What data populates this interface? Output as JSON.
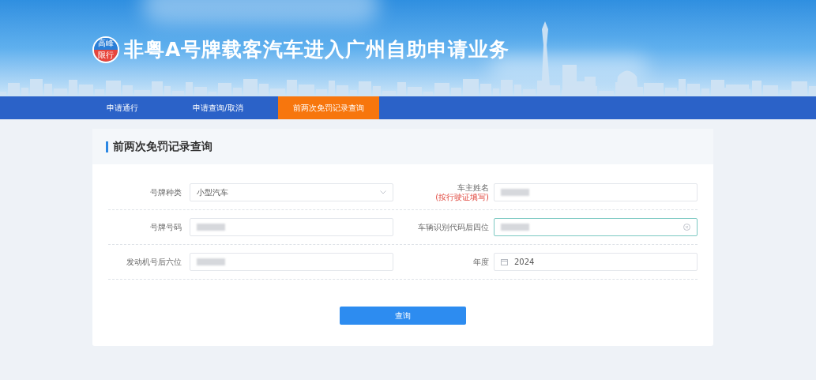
{
  "header": {
    "badge": [
      "高峰",
      "限行"
    ],
    "title": "非粤A号牌载客汽车进入广州自助申请业务"
  },
  "nav": [
    {
      "label": "申请通行",
      "selected": false
    },
    {
      "label": "申请查询/取消",
      "selected": false
    },
    {
      "label": "前两次免罚记录查询",
      "selected": true
    }
  ],
  "form": {
    "title": "前两次免罚记录查询",
    "rows": [
      [
        {
          "kind": "select",
          "label": "号牌种类",
          "value": "小型汽车",
          "focused": false
        },
        {
          "kind": "text",
          "label": "车主姓名",
          "note": "(按行驶证填写)",
          "masked": true,
          "focused": false
        }
      ],
      [
        {
          "kind": "text",
          "label": "号牌号码",
          "masked": true,
          "focused": false
        },
        {
          "kind": "text",
          "label": "车辆识别代码后四位",
          "masked": true,
          "focused": true
        }
      ],
      [
        {
          "kind": "text",
          "label": "发动机号后六位",
          "masked": true,
          "focused": false
        },
        {
          "kind": "date",
          "label": "年度",
          "value": "2024",
          "focused": false
        }
      ]
    ],
    "button": "查询"
  }
}
